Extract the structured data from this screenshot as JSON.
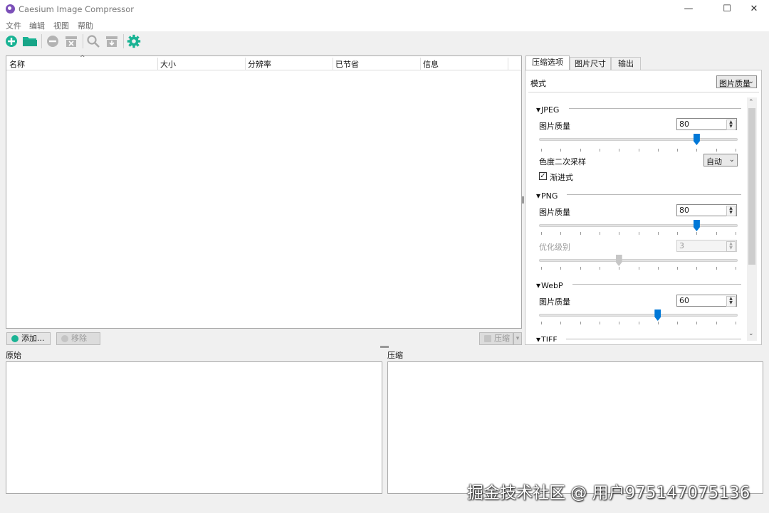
{
  "window": {
    "title": "Caesium Image Compressor",
    "controls": {
      "minimize": "—",
      "maximize": "☐",
      "close": "✕"
    }
  },
  "menu": [
    "文件",
    "编辑",
    "视图",
    "帮助"
  ],
  "toolbar": {
    "icons": [
      "add-file-icon",
      "open-folder-icon",
      "remove-icon",
      "clear-list-icon",
      "preview-icon",
      "export-icon",
      "settings-icon"
    ],
    "accent_color": "#1ab394"
  },
  "table": {
    "columns": [
      "名称",
      "大小",
      "分辨率",
      "已节省",
      "信息"
    ],
    "sort_indicator": "^"
  },
  "buttons": {
    "add": "添加...",
    "remove": "移除",
    "compress": "压缩"
  },
  "preview": {
    "original_label": "原始",
    "compressed_label": "压缩"
  },
  "tabs": [
    "压缩选项",
    "图片尺寸",
    "输出"
  ],
  "options": {
    "mode_label": "模式",
    "mode_value": "图片质量",
    "jpeg": {
      "title": "JPEG",
      "quality_label": "图片质量",
      "quality": "80",
      "quality_fraction": 0.8,
      "subsampling_label": "色度二次采样",
      "subsampling_value": "自动",
      "progressive_label": "渐进式",
      "progressive_checked": "✓"
    },
    "png": {
      "title": "PNG",
      "quality_label": "图片质量",
      "quality": "80",
      "quality_fraction": 0.8,
      "optimization_label": "优化级别",
      "optimization": "3",
      "optimization_fraction": 0.4
    },
    "webp": {
      "title": "WebP",
      "quality_label": "图片质量",
      "quality": "60",
      "quality_fraction": 0.6
    },
    "tiff": {
      "title": "TIFF"
    }
  },
  "watermark": "掘金技术社区 @ 用户975147075136"
}
